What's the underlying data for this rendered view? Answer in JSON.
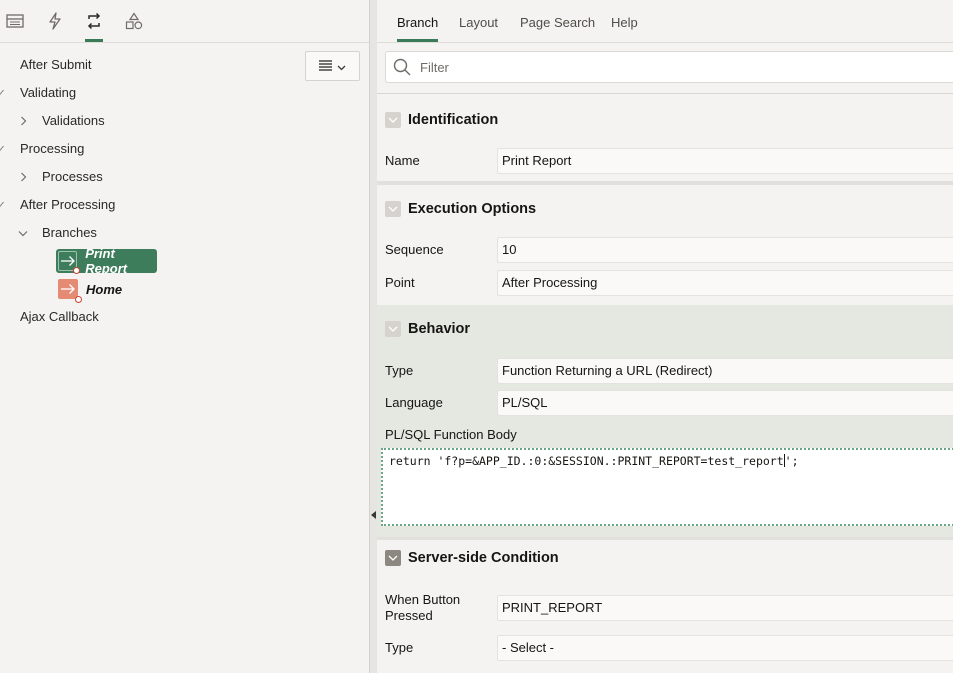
{
  "left_tabs": [
    {
      "name": "rendering-icon",
      "active": false
    },
    {
      "name": "dynamic-actions-icon",
      "active": false
    },
    {
      "name": "processing-icon",
      "active": true
    },
    {
      "name": "shared-components-icon",
      "active": false
    }
  ],
  "tree": {
    "after_submit": "After Submit",
    "validating": "Validating",
    "validations": "Validations",
    "processing": "Processing",
    "processes": "Processes",
    "after_processing": "After Processing",
    "branches": "Branches",
    "branch_items": [
      "Print Report",
      "Home"
    ],
    "ajax_callback": "Ajax Callback"
  },
  "right_tabs": [
    "Branch",
    "Layout",
    "Page Search",
    "Help"
  ],
  "filter": {
    "placeholder": "Filter"
  },
  "identification": {
    "title": "Identification",
    "name_label": "Name",
    "name_value": "Print Report"
  },
  "execution": {
    "title": "Execution Options",
    "sequence_label": "Sequence",
    "sequence_value": "10",
    "point_label": "Point",
    "point_value": "After Processing"
  },
  "behavior": {
    "title": "Behavior",
    "type_label": "Type",
    "type_value": "Function Returning a URL (Redirect)",
    "language_label": "Language",
    "language_value": "PL/SQL",
    "body_label": "PL/SQL Function Body",
    "code_before": "return 'f?p=&APP_ID.:0:&SESSION.:PRINT_REPORT=test_report",
    "code_after": "';"
  },
  "condition": {
    "title": "Server-side Condition",
    "when_button_label_line1": "When Button",
    "when_button_label_line2": "Pressed",
    "when_button_value": "PRINT_REPORT",
    "type_label": "Type",
    "type_value": "- Select -"
  },
  "colors": {
    "accent": "#3a7a57",
    "branch_selected": "#3e7d5c",
    "branch_icon": "#e58a73"
  }
}
